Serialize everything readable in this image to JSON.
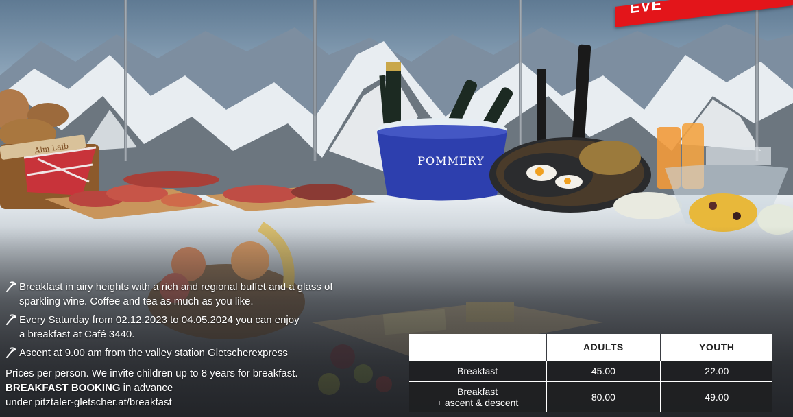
{
  "banner": {
    "text": "EVE"
  },
  "scene": {
    "bucket_brand": "POMMERY",
    "bread_label": "Alm Laib"
  },
  "info": {
    "bullet1_line1": "Breakfast in airy heights with a rich and regional buffet and a glass of",
    "bullet1_line2": "sparkling wine. Coffee and tea as much as you like.",
    "bullet2_line1": "Every Saturday from 02.12.2023 to 04.05.2024 you can enjoy",
    "bullet2_line2": "a breakfast at Café 3440.",
    "bullet3": "Ascent at 9.00 am from the valley station Gletscherexpress",
    "prices_note": "Prices per person. We invite children up to 8 years for breakfast.",
    "booking_bold": "BREAKFAST BOOKING",
    "booking_rest": " in advance",
    "booking_url": "under pitztaler-gletscher.at/breakfast"
  },
  "price_table": {
    "headers": [
      "",
      "ADULTS",
      "YOUTH"
    ],
    "rows": [
      {
        "label_line1": "Breakfast",
        "label_line2": "",
        "adults": "45.00",
        "youth": "22.00"
      },
      {
        "label_line1": "Breakfast",
        "label_line2": "+ ascent & descent",
        "adults": "80.00",
        "youth": "49.00"
      }
    ]
  },
  "colors": {
    "banner": "#e3151a",
    "table_dark": "#1e1f22",
    "table_header": "#ffffff",
    "bucket": "#2d3fae"
  },
  "icons": [
    "ice-axe-icon"
  ]
}
